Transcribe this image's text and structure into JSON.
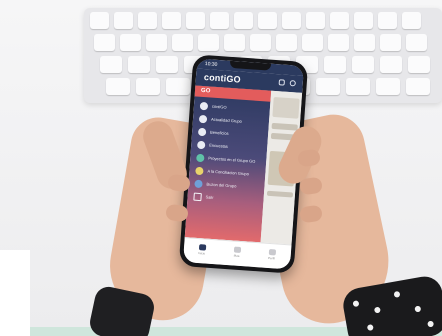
{
  "phone": {
    "status_time": "10:30",
    "app_brand": "contiGO",
    "menu": {
      "active_label": "GO",
      "items": [
        {
          "label": "contiGO",
          "icon": "home-icon"
        },
        {
          "label": "Actualidad Grupo",
          "icon": "news-icon"
        },
        {
          "label": "Beneficios",
          "icon": "gift-icon"
        },
        {
          "label": "Encuestas",
          "icon": "survey-icon"
        },
        {
          "label": "Proyectos en el Grupo GO",
          "icon": "projects-icon"
        },
        {
          "label": "A la Conciliacion Grupo",
          "icon": "balance-icon"
        },
        {
          "label": "Buzon del Grupo",
          "icon": "mailbox-icon"
        },
        {
          "label": "Salir",
          "icon": "exit-icon"
        }
      ]
    },
    "tabs": [
      {
        "label": "Inicio",
        "icon": "home-tab-icon"
      },
      {
        "label": "Mas",
        "icon": "more-tab-icon"
      },
      {
        "label": "Perfil",
        "icon": "profile-tab-icon"
      }
    ]
  }
}
